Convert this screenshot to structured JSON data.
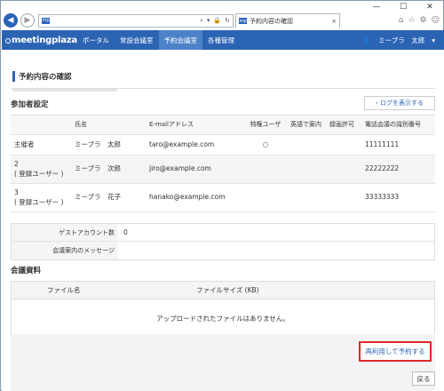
{
  "window": {
    "minimize": "—",
    "maximize": "☐",
    "close": "✕"
  },
  "browser": {
    "back_icon": "arrow-left",
    "address": "",
    "address_favicon": "mp",
    "tab_title": "予約内容の確認",
    "tab_favicon": "mp",
    "tab_close": "×"
  },
  "header": {
    "logo": "meetingplaza",
    "nav": [
      "ポータル",
      "常設会議室",
      "予約会議室",
      "各種管理"
    ],
    "active_nav": "予約会議室",
    "user_name": "ミープラ　太郎"
  },
  "page": {
    "title": "予約内容の確認"
  },
  "participants": {
    "section_title": "参加者設定",
    "log_button": "› ログを表示する",
    "headers": [
      "",
      "氏名",
      "E-mailアドレス",
      "特権ユーザ",
      "英語で案内",
      "録画許可",
      "電話会議の識別番号"
    ],
    "rows": [
      {
        "role": "主催者",
        "role2": "",
        "name": "ミープラ　太郎",
        "email": "taro@example.com",
        "priv": "○",
        "en": "",
        "rec": "",
        "tel": "11111111"
      },
      {
        "role": "2",
        "role2": "( 登録ユーザー )",
        "name": "ミープラ　次郎",
        "email": "jiro@example.com",
        "priv": "",
        "en": "",
        "rec": "",
        "tel": "22222222"
      },
      {
        "role": "3",
        "role2": "( 登録ユーザー )",
        "name": "ミープラ　花子",
        "email": "hanako@example.com",
        "priv": "",
        "en": "",
        "rec": "",
        "tel": "33333333"
      }
    ]
  },
  "guest": {
    "account_label": "ゲストアカウント数",
    "account_value": "0",
    "message_label": "会議案内のメッセージ",
    "message_value": ""
  },
  "files": {
    "section_title": "会議資料",
    "col_name": "ファイル名",
    "col_size": "ファイルサイズ (KB)",
    "empty_text": "アップロードされたファイルはありません。"
  },
  "actions": {
    "reuse_button": "再利用して予約する",
    "back_button": "戻る"
  },
  "colors": {
    "brand": "#2c64b4",
    "highlight": "#e0262a"
  }
}
